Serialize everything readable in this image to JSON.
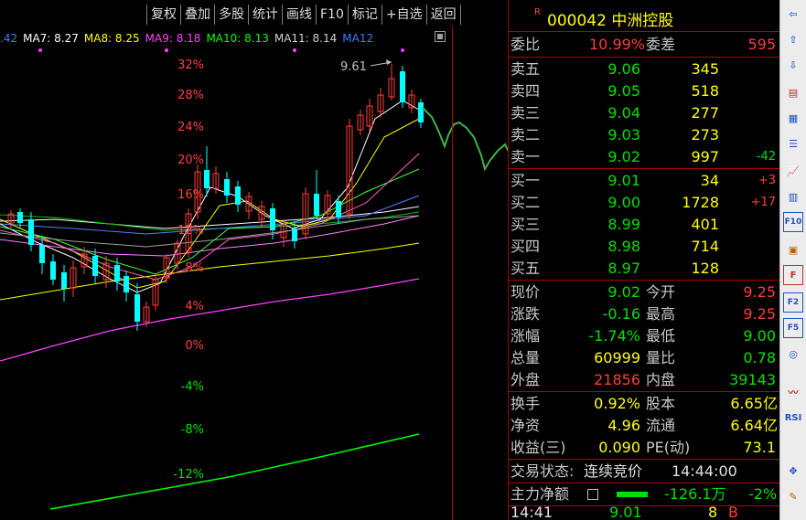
{
  "toolbar": {
    "buttons": [
      "复权",
      "叠加",
      "多股",
      "统计",
      "画线",
      "F10",
      "标记",
      "+自选",
      "返回"
    ]
  },
  "ma_legend": [
    {
      "label": ".42",
      "color": "#3c7cff"
    },
    {
      "label": "MA7: 8.27",
      "color": "#ffffff"
    },
    {
      "label": "MA8: 8.25",
      "color": "#ffff00"
    },
    {
      "label": "MA9: 8.18",
      "color": "#ff40ff"
    },
    {
      "label": "MA10: 8.13",
      "color": "#00ff00"
    },
    {
      "label": "MA11: 8.14",
      "color": "#d0d0d0"
    },
    {
      "label": "MA12",
      "color": "#3c7cff"
    }
  ],
  "price_axis": {
    "labels": [
      "32%",
      "28%",
      "24%",
      "20%",
      "16%",
      "12%",
      "8%",
      "4%",
      "0%",
      "-4%",
      "-8%",
      "-12%"
    ],
    "peak_annotation": "9.61"
  },
  "stock": {
    "marker": "R",
    "code": "000042",
    "name": "中洲控股"
  },
  "order_book": {
    "webi_label": "委比",
    "webi_value": "10.99%",
    "weicha_label": "委差",
    "weicha_value": "595",
    "asks": [
      {
        "label": "卖五",
        "price": "9.06",
        "volume": "345",
        "change": ""
      },
      {
        "label": "卖四",
        "price": "9.05",
        "volume": "518",
        "change": ""
      },
      {
        "label": "卖三",
        "price": "9.04",
        "volume": "277",
        "change": ""
      },
      {
        "label": "卖二",
        "price": "9.03",
        "volume": "273",
        "change": ""
      },
      {
        "label": "卖一",
        "price": "9.02",
        "volume": "997",
        "change": "-42"
      }
    ],
    "bids": [
      {
        "label": "买一",
        "price": "9.01",
        "volume": "34",
        "change": "+3"
      },
      {
        "label": "买二",
        "price": "9.00",
        "volume": "1728",
        "change": "+17"
      },
      {
        "label": "买三",
        "price": "8.99",
        "volume": "401",
        "change": ""
      },
      {
        "label": "买四",
        "price": "8.98",
        "volume": "714",
        "change": ""
      },
      {
        "label": "买五",
        "price": "8.97",
        "volume": "128",
        "change": ""
      }
    ]
  },
  "quote": {
    "now_label": "现价",
    "now": "9.02",
    "open_label": "今开",
    "open": "9.25",
    "chg_label": "涨跌",
    "chg": "-0.16",
    "high_label": "最高",
    "high": "9.25",
    "pct_label": "涨幅",
    "pct": "-1.74%",
    "low_label": "最低",
    "low": "9.00",
    "vol_label": "总量",
    "vol": "60999",
    "ratio_label": "量比",
    "ratio": "0.78",
    "outer_label": "外盘",
    "outer": "21856",
    "inner_label": "内盘",
    "inner": "39143"
  },
  "fundamentals": {
    "turnover_label": "换手",
    "turnover": "0.92%",
    "shares_label": "股本",
    "shares": "6.65亿",
    "netasset_label": "净资",
    "netasset": "4.96",
    "float_label": "流通",
    "float": "6.64亿",
    "eps_label": "收益(三)",
    "eps": "0.090",
    "pe_label": "PE(动)",
    "pe": "73.1"
  },
  "status": {
    "label": "交易状态:",
    "value": "连续竞价",
    "time": "14:44:00"
  },
  "netflow": {
    "label": "主力净额",
    "value": "-126.1万",
    "pct": "-2%"
  },
  "tick": {
    "time": "14:41",
    "price": "9.01",
    "vol": "8",
    "side": "B"
  },
  "colors": {
    "up": "#ff3c3c",
    "down": "#00e000",
    "accent": "#ffff00",
    "grid_red": "#b00000"
  },
  "sidebar_icons": [
    "arrow-left-icon",
    "arrow-up-icon",
    "arrow-down-icon",
    "book-icon",
    "table-icon",
    "list-icon",
    "chart-icon",
    "candle-icon",
    "news-icon",
    "f10-icon",
    "f-icon",
    "notebook-icon",
    "f2-icon",
    "f5-icon",
    "circle-icon",
    "wave-icon",
    "rsi-icon",
    "move-icon",
    "pen-icon"
  ]
}
